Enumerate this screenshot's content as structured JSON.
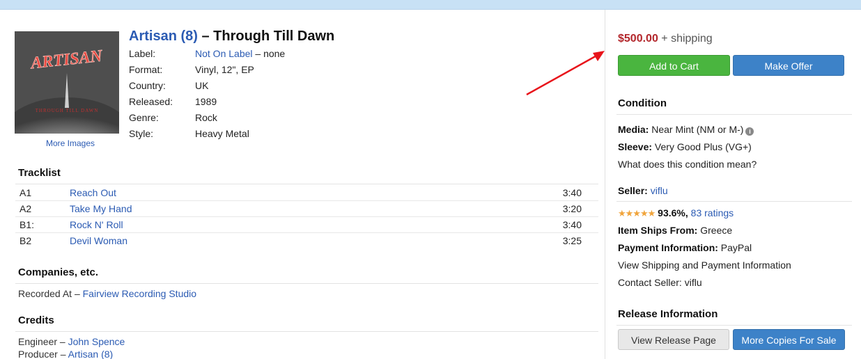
{
  "release": {
    "artist": "Artisan (8)",
    "separator": " – ",
    "title": "Through Till Dawn",
    "cover_logo": "ARTISAN",
    "cover_caption": "THROUGH TILL DAWN",
    "more_images": "More Images",
    "profile": [
      {
        "key": "Label:",
        "value_link": "Not On Label",
        "value_rest": " – none"
      },
      {
        "key": "Format:",
        "value": "Vinyl, 12\", EP"
      },
      {
        "key": "Country:",
        "value": "UK"
      },
      {
        "key": "Released:",
        "value": "1989"
      },
      {
        "key": "Genre:",
        "value": "Rock"
      },
      {
        "key": "Style:",
        "value": "Heavy Metal"
      }
    ]
  },
  "tracklist": {
    "heading": "Tracklist",
    "tracks": [
      {
        "position": "A1",
        "title": "Reach Out",
        "duration": "3:40"
      },
      {
        "position": "A2",
        "title": "Take My Hand",
        "duration": "3:20"
      },
      {
        "position": "B1:",
        "title": "Rock N' Roll",
        "duration": "3:40"
      },
      {
        "position": "B2",
        "title": "Devil Woman",
        "duration": "3:25"
      }
    ]
  },
  "companies": {
    "heading": "Companies, etc.",
    "role": "Recorded At – ",
    "name": "Fairview Recording Studio"
  },
  "credits": {
    "heading": "Credits",
    "items": [
      {
        "role": "Engineer – ",
        "name": "John Spence"
      },
      {
        "role": "Producer – ",
        "name": "Artisan (8)"
      }
    ]
  },
  "sidebar": {
    "price": "$500.00",
    "shipping": " + shipping",
    "add_to_cart": "Add to Cart",
    "make_offer": "Make Offer",
    "condition_heading": "Condition",
    "media_label": "Media:",
    "media_value": " Near Mint (NM or M-)",
    "sleeve_label": "Sleeve:",
    "sleeve_value": " Very Good Plus (VG+)",
    "condition_link": "What does this condition mean?",
    "seller_label": "Seller:",
    "seller_name": "viflu",
    "rating_stars": "★★★★★",
    "rating_pct": "93.6%,",
    "rating_count": "83 ratings",
    "ships_label": "Item Ships From:",
    "ships_value": " Greece",
    "payment_label": "Payment Information:",
    "payment_value": " PayPal",
    "shipping_info_link": "View Shipping and Payment Information",
    "contact_link": "Contact Seller: viflu",
    "release_info_heading": "Release Information",
    "view_release": "View Release Page",
    "more_copies": "More Copies For Sale"
  },
  "colors": {
    "price": "#b3272c",
    "link": "#2b5bb3",
    "cart_button": "#4ab53f",
    "offer_button": "#3d82c8",
    "annotation_arrow": "#e8141b"
  }
}
